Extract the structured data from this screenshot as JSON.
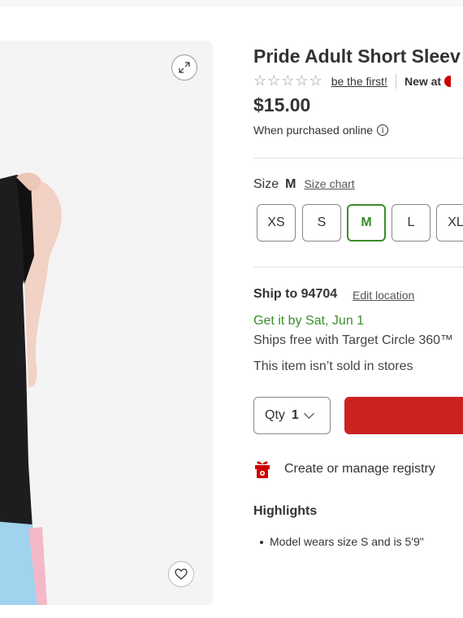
{
  "product": {
    "title": "Pride Adult Short Sleev",
    "rating": {
      "stars_icon": "star-outline-icon",
      "stars": "☆☆☆☆☆",
      "first_review_link": "be the first!",
      "new_at_label": "New at"
    },
    "price": "$15.00",
    "purchase_note": "When purchased online",
    "info_icon": "info-icon"
  },
  "size": {
    "label": "Size",
    "selected": "M",
    "chart_link": "Size chart",
    "options": [
      "XS",
      "S",
      "M",
      "L",
      "XL"
    ]
  },
  "shipping": {
    "ship_to": "Ship to 94704",
    "edit_location": "Edit location",
    "delivery_date": "Get it by Sat, Jun 1",
    "ships_free": "Ships free with Target Circle 360™",
    "store_note": "This item isn’t sold in stores"
  },
  "cart": {
    "qty_label": "Qty",
    "qty_value": "1",
    "add_button_color": "#cc2222"
  },
  "registry": {
    "icon": "gift-icon",
    "label": "Create or manage registry"
  },
  "highlights": {
    "title": "Highlights",
    "items": [
      "Model wears size S and is 5'9\""
    ]
  },
  "image": {
    "expand_icon": "expand-icon",
    "favorite_icon": "heart-icon"
  },
  "colors": {
    "brand_red": "#cc0000",
    "selected_green": "#3a8d2a"
  }
}
